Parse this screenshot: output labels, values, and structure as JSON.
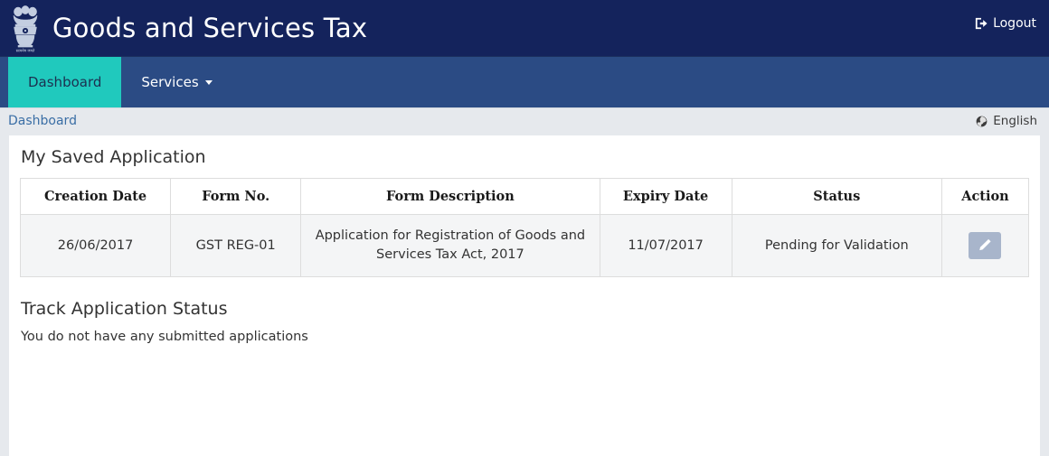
{
  "header": {
    "emblem_icon": "india-national-emblem",
    "title": "Goods and Services Tax",
    "logout_label": "Logout",
    "logout_icon": "sign-out-icon",
    "background_color": "#14235c"
  },
  "nav": {
    "background_color": "#2b4b84",
    "active_color": "#20c9bd",
    "items": [
      {
        "label": "Dashboard",
        "active": true,
        "has_caret": false
      },
      {
        "label": "Services",
        "active": false,
        "has_caret": true
      }
    ]
  },
  "breadcrumb": {
    "label": "Dashboard",
    "link_color": "#3a6ea5"
  },
  "language": {
    "label": "English",
    "icon": "globe-icon"
  },
  "saved_application": {
    "title": "My Saved Application",
    "columns": [
      "Creation Date",
      "Form No.",
      "Form Description",
      "Expiry Date",
      "Status",
      "Action"
    ],
    "rows": [
      {
        "creation_date": "26/06/2017",
        "form_no": "GST REG-01",
        "form_description": "Application for Registration of Goods and Services Tax Act, 2017",
        "expiry_date": "11/07/2017",
        "status": "Pending for Validation",
        "action_icon": "pencil-edit-icon",
        "action_color": "#a8b5cb"
      }
    ]
  },
  "track_application": {
    "title": "Track Application Status",
    "message": "You do not have any submitted applications"
  }
}
